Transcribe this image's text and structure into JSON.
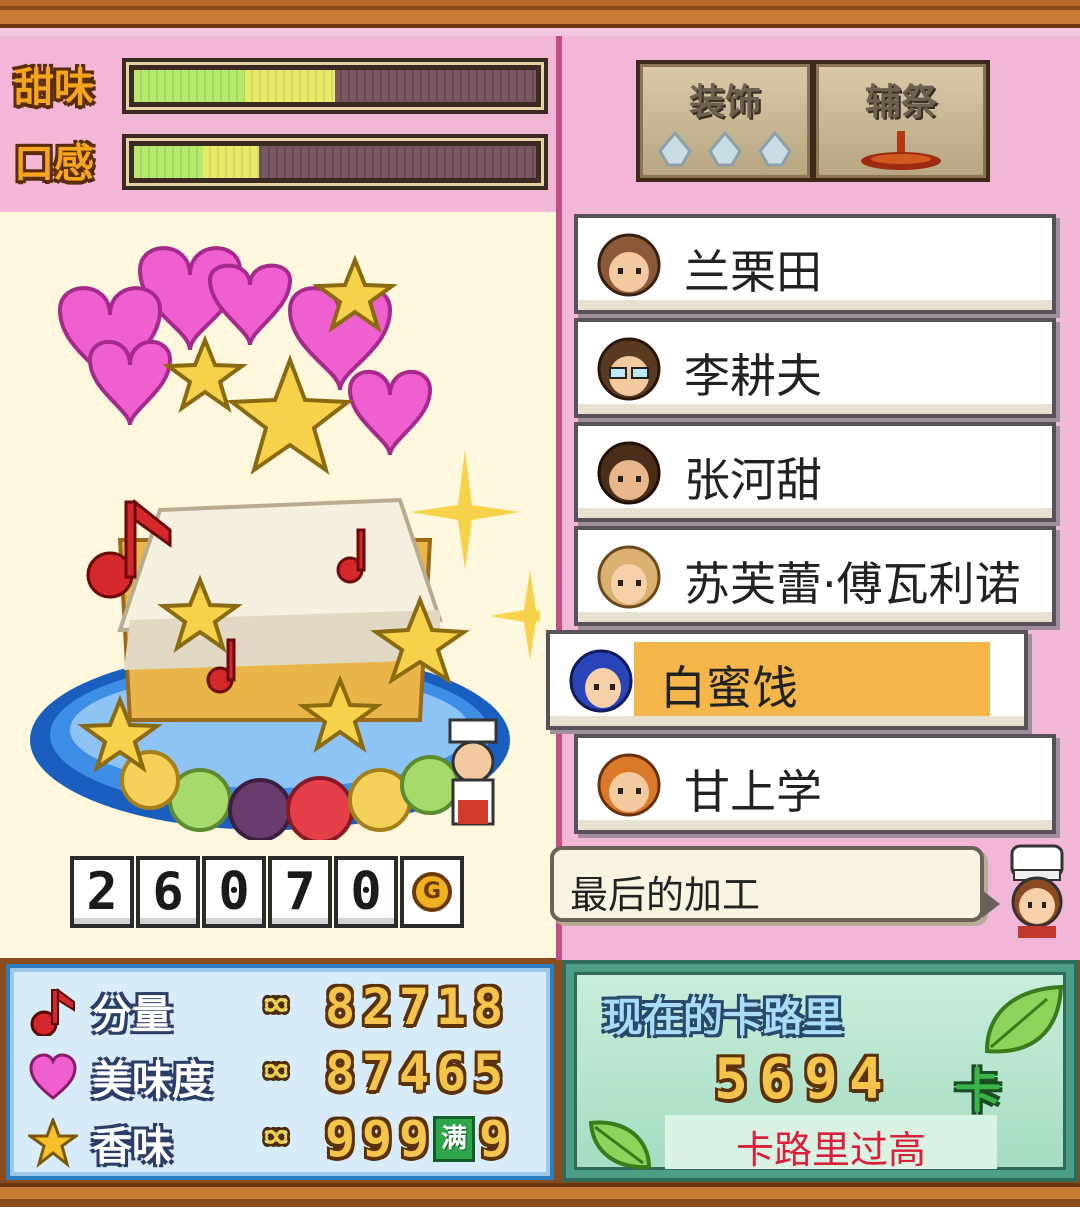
{
  "meters": [
    {
      "label": "甜味",
      "fill": 0.5
    },
    {
      "label": "口感",
      "fill": 0.31
    }
  ],
  "decorate": {
    "buttons": [
      {
        "label": "装饰",
        "icon": "gem-slots-icon"
      },
      {
        "label": "辅祭",
        "icon": "stand-icon"
      }
    ]
  },
  "npc_list": [
    {
      "name": "兰栗田",
      "avatar": "brown-hair-avatar-icon",
      "hair": "#8a5a3a",
      "skin": "#f3c9a0"
    },
    {
      "name": "李耕夫",
      "avatar": "glasses-avatar-icon",
      "hair": "#5b3a22",
      "skin": "#f3c9a0"
    },
    {
      "name": "张河甜",
      "avatar": "short-hair-avatar-icon",
      "hair": "#4a2e1a",
      "skin": "#e9b58a"
    },
    {
      "name": "苏芙蕾·傅瓦利诺",
      "avatar": "blonde-avatar-icon",
      "hair": "#d9b070",
      "skin": "#f5d0a8"
    },
    {
      "name": "白蜜饯",
      "avatar": "blue-hair-avatar-icon",
      "hair": "#2a45b8",
      "skin": "#f5d0a8",
      "selected": true
    },
    {
      "name": "甘上学",
      "avatar": "orange-hair-avatar-icon",
      "hair": "#d97a2a",
      "skin": "#f3c9a0"
    }
  ],
  "bubble": {
    "text": "最后的加工"
  },
  "gold": {
    "digits": [
      "2",
      "6",
      "0",
      "7",
      "0"
    ],
    "coin_symbol": "G"
  },
  "stats": [
    {
      "label": "分量",
      "icon": "music-note-icon",
      "prefix": "∞",
      "digits": [
        "8",
        "2",
        "7",
        "1",
        "8"
      ]
    },
    {
      "label": "美味度",
      "icon": "heart-icon",
      "prefix": "∞",
      "digits": [
        "8",
        "7",
        "4",
        "6",
        "5"
      ]
    },
    {
      "label": "香味",
      "icon": "star-icon",
      "prefix": "∞",
      "digits": [
        "9",
        "9",
        "9",
        "满",
        "9"
      ]
    }
  ],
  "calorie": {
    "title": "现在的卡路里",
    "value": [
      "5",
      "6",
      "9",
      "4"
    ],
    "unit": "卡",
    "warning": "卡路里过高"
  },
  "colors": {
    "accent": "#f4b54a",
    "warning": "#d9203a"
  }
}
